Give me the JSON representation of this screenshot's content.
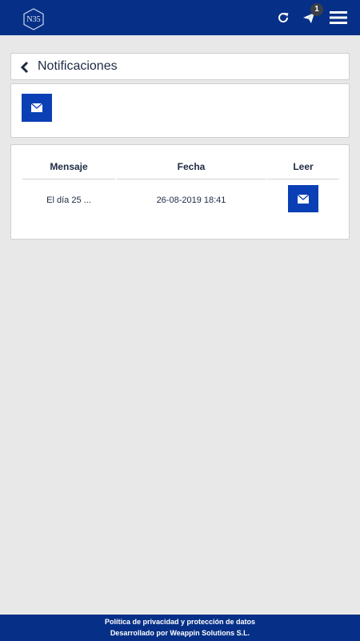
{
  "navbar": {
    "logo_text": "N35",
    "icons": [
      "refresh-icon",
      "send-icon",
      "menu-icon"
    ],
    "notification_count": "1"
  },
  "header": {
    "title": "Notificaciones"
  },
  "actions": {
    "icon": "envelope-icon"
  },
  "table": {
    "columns": [
      "Mensaje",
      "Fecha",
      "Leer"
    ],
    "rows": [
      {
        "message": "El día 25 ...",
        "date": "26-08-2019 18:41"
      }
    ]
  },
  "footer": {
    "privacy": "Política de privacidad y protección de datos",
    "developer": "Desarrollado por Weappin Solutions S.L."
  },
  "colors": {
    "primary": "#063087",
    "button": "#0a3fb5",
    "background": "#e8e8e8"
  }
}
